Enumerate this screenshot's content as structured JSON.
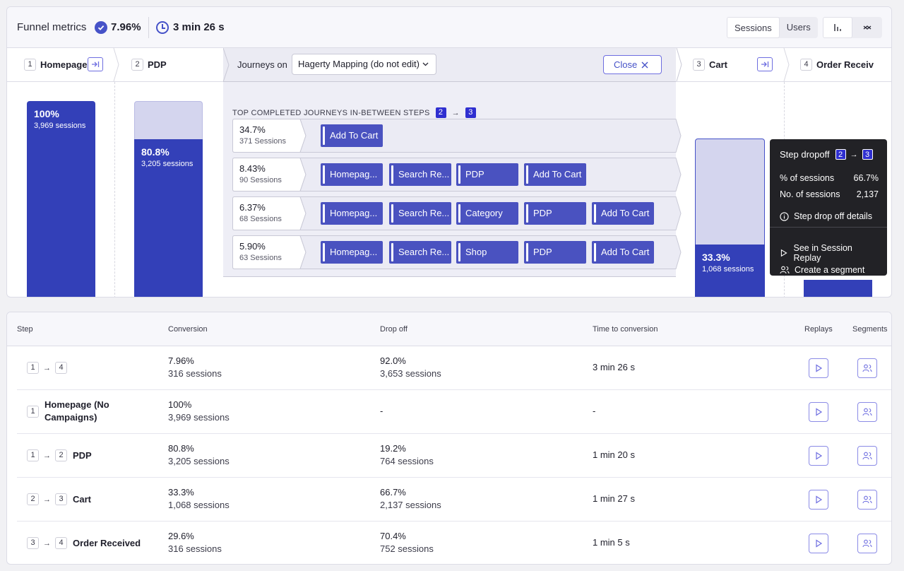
{
  "header": {
    "title": "Funnel metrics",
    "conversion": "7.96%",
    "time": "3 min 26 s",
    "mode_options": [
      "Sessions",
      "Users"
    ],
    "mode_selected": "Sessions",
    "view_icons": [
      "bar-chart-icon",
      "trend-chart-icon"
    ]
  },
  "steps": [
    {
      "num": "1",
      "label": "Homepage"
    },
    {
      "num": "2",
      "label": "PDP"
    },
    {
      "num": "3",
      "label": "Cart"
    },
    {
      "num": "4",
      "label": "Order Receiv"
    }
  ],
  "journeys_bar": {
    "label": "Journeys on",
    "selected": "Hagerty Mapping (do not edit)",
    "close_label": "Close"
  },
  "bars": [
    {
      "pct": "100%",
      "sessions": "3,969 sessions",
      "fill": 1.0
    },
    {
      "pct": "80.8%",
      "sessions": "3,205 sessions",
      "fill": 0.808
    },
    {
      "pct": "33.3%",
      "sessions": "1,068 sessions",
      "fill": 0.333
    }
  ],
  "journeys": {
    "title": "TOP COMPLETED JOURNEYS IN-BETWEEN STEPS",
    "from": "2",
    "to": "3",
    "rows": [
      {
        "pct": "34.7%",
        "sessions": "371 Sessions",
        "steps": [
          "Add To Cart"
        ]
      },
      {
        "pct": "8.43%",
        "sessions": "90 Sessions",
        "steps": [
          "Homepag...",
          "Search Re...",
          "PDP",
          "Add To Cart"
        ]
      },
      {
        "pct": "6.37%",
        "sessions": "68 Sessions",
        "steps": [
          "Homepag...",
          "Search Re...",
          "Category",
          "PDP",
          "Add To Cart"
        ]
      },
      {
        "pct": "5.90%",
        "sessions": "63 Sessions",
        "steps": [
          "Homepag...",
          "Search Re...",
          "Shop",
          "PDP",
          "Add To Cart"
        ]
      }
    ]
  },
  "tooltip": {
    "title": "Step dropoff",
    "from": "2",
    "to": "3",
    "pct_label": "% of sessions",
    "pct_value": "66.7%",
    "num_label": "No. of sessions",
    "num_value": "2,137",
    "details": "Step drop off details",
    "replay": "See in Session Replay",
    "segment": "Create a segment"
  },
  "table": {
    "headers": {
      "step": "Step",
      "conversion": "Conversion",
      "dropoff": "Drop off",
      "time": "Time to conversion",
      "replays": "Replays",
      "segments": "Segments"
    },
    "rows": [
      {
        "from": "1",
        "to": "4",
        "name": "",
        "conv": "7.96%",
        "conv_sess": "316 sessions",
        "drop": "92.0%",
        "drop_sess": "3,653 sessions",
        "time": "3 min 26 s"
      },
      {
        "from": "1",
        "to": "",
        "name": "Homepage (No Campaigns)",
        "conv": "100%",
        "conv_sess": "3,969 sessions",
        "drop": "-",
        "drop_sess": "",
        "time": "-"
      },
      {
        "from": "1",
        "to": "2",
        "name": "PDP",
        "conv": "80.8%",
        "conv_sess": "3,205 sessions",
        "drop": "19.2%",
        "drop_sess": "764 sessions",
        "time": "1 min 20 s"
      },
      {
        "from": "2",
        "to": "3",
        "name": "Cart",
        "conv": "33.3%",
        "conv_sess": "1,068 sessions",
        "drop": "66.7%",
        "drop_sess": "2,137 sessions",
        "time": "1 min 27 s"
      },
      {
        "from": "3",
        "to": "4",
        "name": "Order Received",
        "conv": "29.6%",
        "conv_sess": "316 sessions",
        "drop": "70.4%",
        "drop_sess": "752 sessions",
        "time": "1 min 5 s"
      }
    ]
  },
  "colors": {
    "bar": "#3340b8",
    "bar_light": "#d4d5ee",
    "accent": "#2f2fd0",
    "chip": "#4a52c0"
  }
}
